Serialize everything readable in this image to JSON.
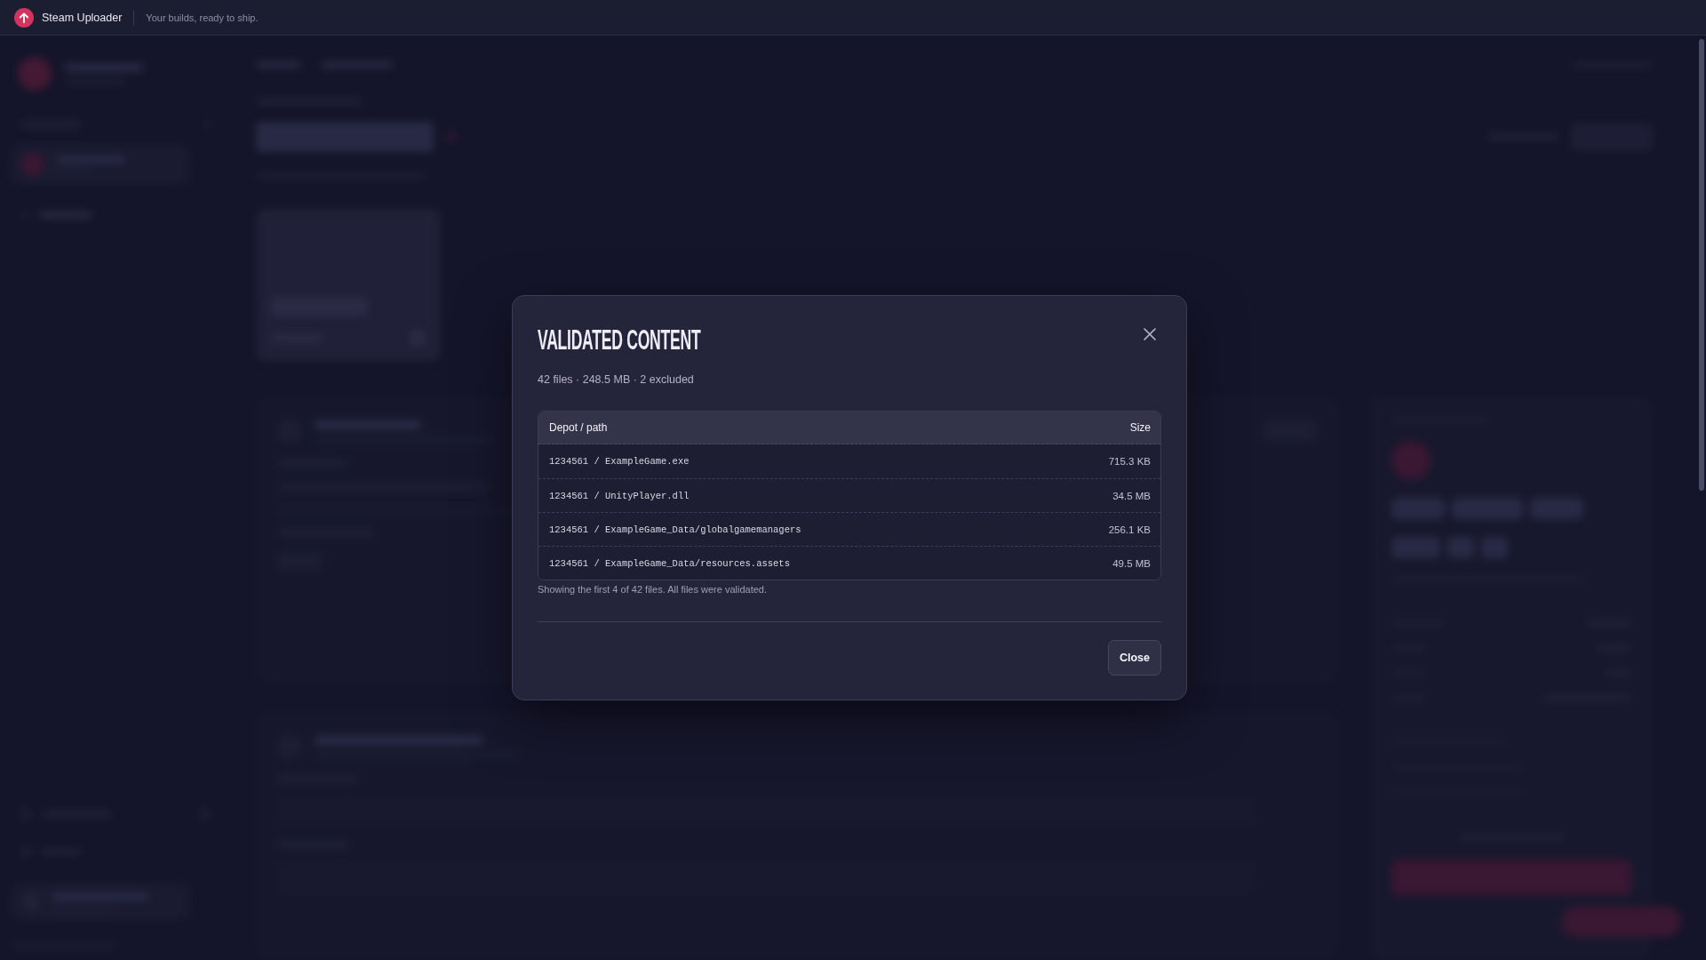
{
  "app_bar": {
    "title": "Steam Uploader",
    "tagline": "Your builds, ready to ship."
  },
  "dialog": {
    "title": "VALIDATED CONTENT",
    "summary": "42 files · 248.5 MB · 2 excluded",
    "table": {
      "columns": [
        "Depot / path",
        "Size"
      ],
      "rows": [
        {
          "path": "1234561 / ExampleGame.exe",
          "size": "715.3 KB"
        },
        {
          "path": "1234561 / UnityPlayer.dll",
          "size": "34.5 MB"
        },
        {
          "path": "1234561 / ExampleGame_Data/globalgamemanagers",
          "size": "256.1 KB"
        },
        {
          "path": "1234561 / ExampleGame_Data/resources.assets",
          "size": "49.5 MB"
        }
      ]
    },
    "note": "Showing the first 4 of 42 files. All files were validated.",
    "buttons": [
      "Close"
    ]
  }
}
